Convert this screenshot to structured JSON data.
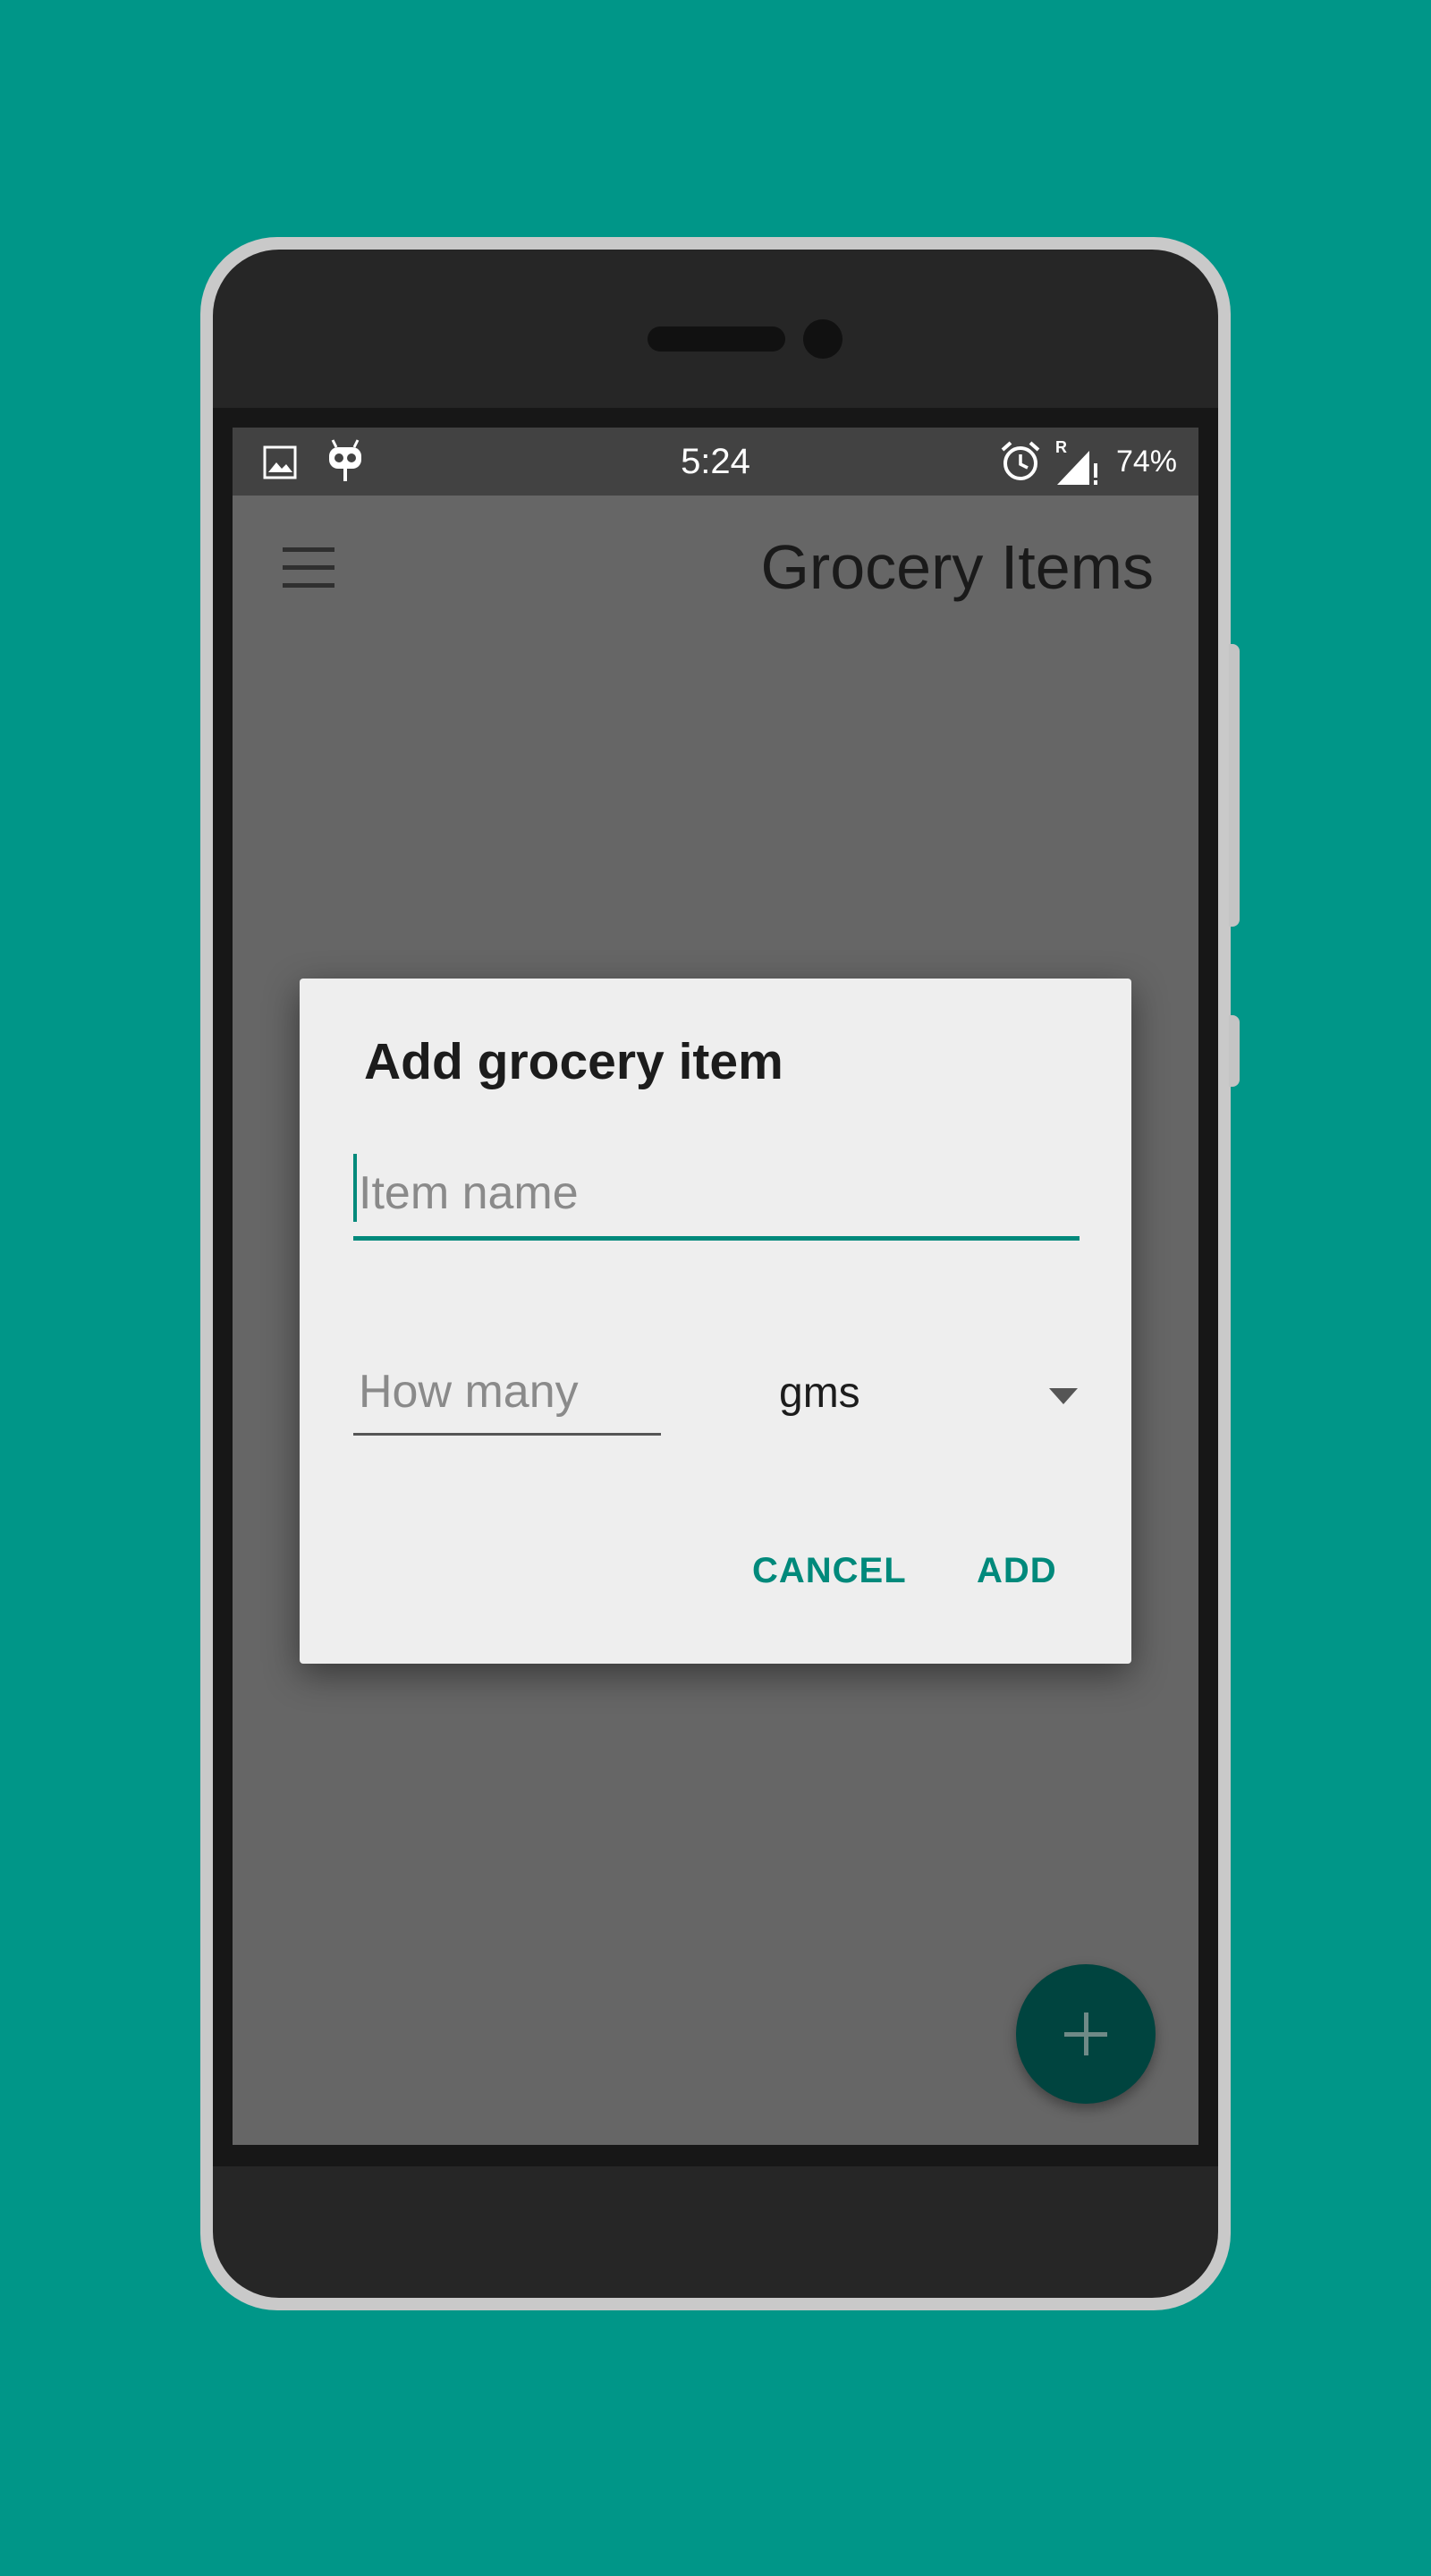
{
  "status_bar": {
    "time": "5:24",
    "battery": "74%",
    "left_icons": [
      "image-icon",
      "android-robot-icon"
    ],
    "right_icons": [
      "alarm-icon",
      "signal-roaming-icon"
    ]
  },
  "app_bar": {
    "title": "Grocery Items",
    "menu_icon": "hamburger-menu-icon"
  },
  "dialog": {
    "title": "Add grocery item",
    "item_name_placeholder": "Item name",
    "quantity_placeholder": "How many",
    "unit_selected": "gms",
    "cancel_label": "CANCEL",
    "add_label": "ADD"
  },
  "fab": {
    "icon": "plus-icon"
  },
  "colors": {
    "background": "#009688",
    "accent": "#00897b",
    "fab": "#00443f",
    "scrim": "#666666"
  }
}
